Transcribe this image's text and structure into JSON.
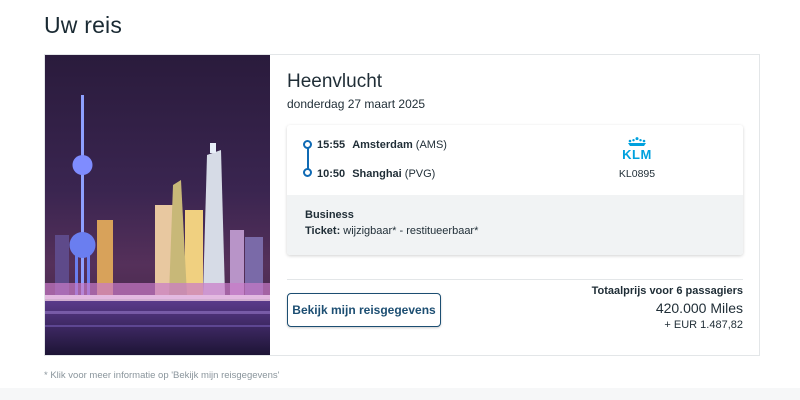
{
  "page": {
    "title": "Uw reis"
  },
  "trip": {
    "image_alt": "Shanghai skyline",
    "flight_title": "Heenvlucht",
    "date": "donderdag 27 maart 2025",
    "departure": {
      "time": "15:55",
      "city": "Amsterdam",
      "code": "(AMS)"
    },
    "arrival": {
      "time": "10:50",
      "city": "Shanghai",
      "code": "(PVG)"
    },
    "airline": {
      "logo_text": "KLM",
      "logo_icon": "klm-crown-icon",
      "flight_number": "KL0895"
    },
    "cabin": "Business",
    "ticket_label": "Ticket:",
    "ticket_value": "wijzigbaar* - restitueerbaar*",
    "details_button": "Bekijk mijn reisgegevens",
    "price": {
      "label": "Totaalprijs voor 6 passagiers",
      "miles": "420.000 Miles",
      "eur": "+ EUR 1.487,82"
    }
  },
  "footnote": "* Klik voor meer informatie op 'Bekijk mijn reisgegevens'",
  "colors": {
    "accent": "#0f6ab4",
    "klm_blue": "#00a1de",
    "button_border": "#1c4e72"
  }
}
